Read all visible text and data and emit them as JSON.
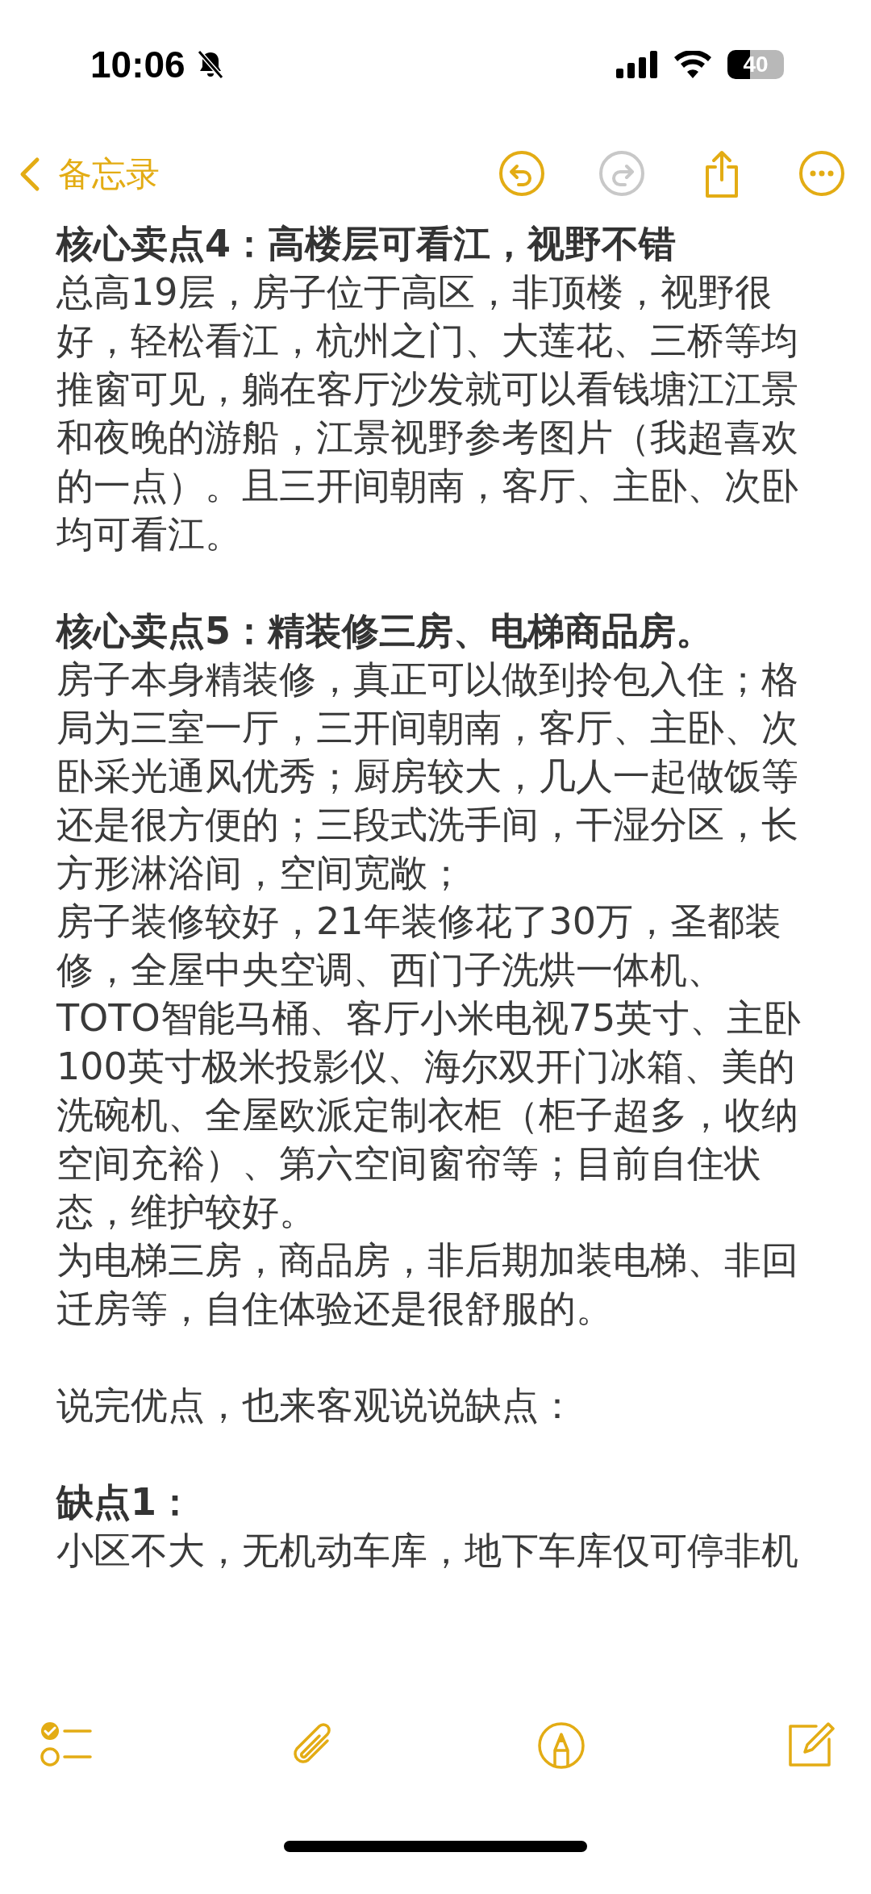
{
  "status_bar": {
    "time": "10:06",
    "silent": true,
    "battery": "40"
  },
  "nav": {
    "back_label": "备忘录",
    "actions": [
      {
        "kind": "undo",
        "disabled": false
      },
      {
        "kind": "redo",
        "disabled": true
      },
      {
        "kind": "share",
        "disabled": false
      },
      {
        "kind": "more",
        "disabled": false
      }
    ]
  },
  "note": {
    "sections": [
      {
        "blocks": [
          {
            "kind": "heading",
            "text": "核心卖点4：高楼层可看江，视野不错"
          },
          {
            "kind": "paragraph",
            "text": "总高19层，房子位于高区，非顶楼，视野很好，轻松看江，杭州之门、大莲花、三桥等均推窗可见，躺在客厅沙发就可以看钱塘江江景和夜晚的游船，江景视野参考图片（我超喜欢的一点）。且三开间朝南，客厅、主卧、次卧均可看江。"
          }
        ]
      },
      {
        "blocks": [
          {
            "kind": "heading",
            "text": "核心卖点5：精装修三房、电梯商品房。"
          },
          {
            "kind": "paragraph",
            "text": "房子本身精装修，真正可以做到拎包入住；格局为三室一厅，三开间朝南，客厅、主卧、次卧采光通风优秀；厨房较大，几人一起做饭等还是很方便的；三段式洗手间，干湿分区，长方形淋浴间，空间宽敞；"
          },
          {
            "kind": "paragraph",
            "text": "房子装修较好，21年装修花了30万，圣都装修，全屋中央空调、西门子洗烘一体机、TOTO智能马桶、客厅小米电视75英寸、主卧100英寸极米投影仪、海尔双开门冰箱、美的洗碗机、全屋欧派定制衣柜（柜子超多，收纳空间充裕）、第六空间窗帘等；目前自住状态，维护较好。"
          },
          {
            "kind": "paragraph",
            "text": "为电梯三房，商品房，非后期加装电梯、非回迁房等，自住体验还是很舒服的。"
          }
        ]
      },
      {
        "blocks": [
          {
            "kind": "paragraph",
            "text": "说完优点，也来客观说说缺点："
          }
        ]
      },
      {
        "blocks": [
          {
            "kind": "heading",
            "text": "缺点1："
          },
          {
            "kind": "paragraph",
            "text": "小区不大，无机动车库，地下车库仅可停非机"
          }
        ]
      }
    ]
  },
  "toolbar": {
    "items": [
      {
        "kind": "checklist"
      },
      {
        "kind": "attachment"
      },
      {
        "kind": "markup"
      },
      {
        "kind": "compose"
      }
    ]
  }
}
